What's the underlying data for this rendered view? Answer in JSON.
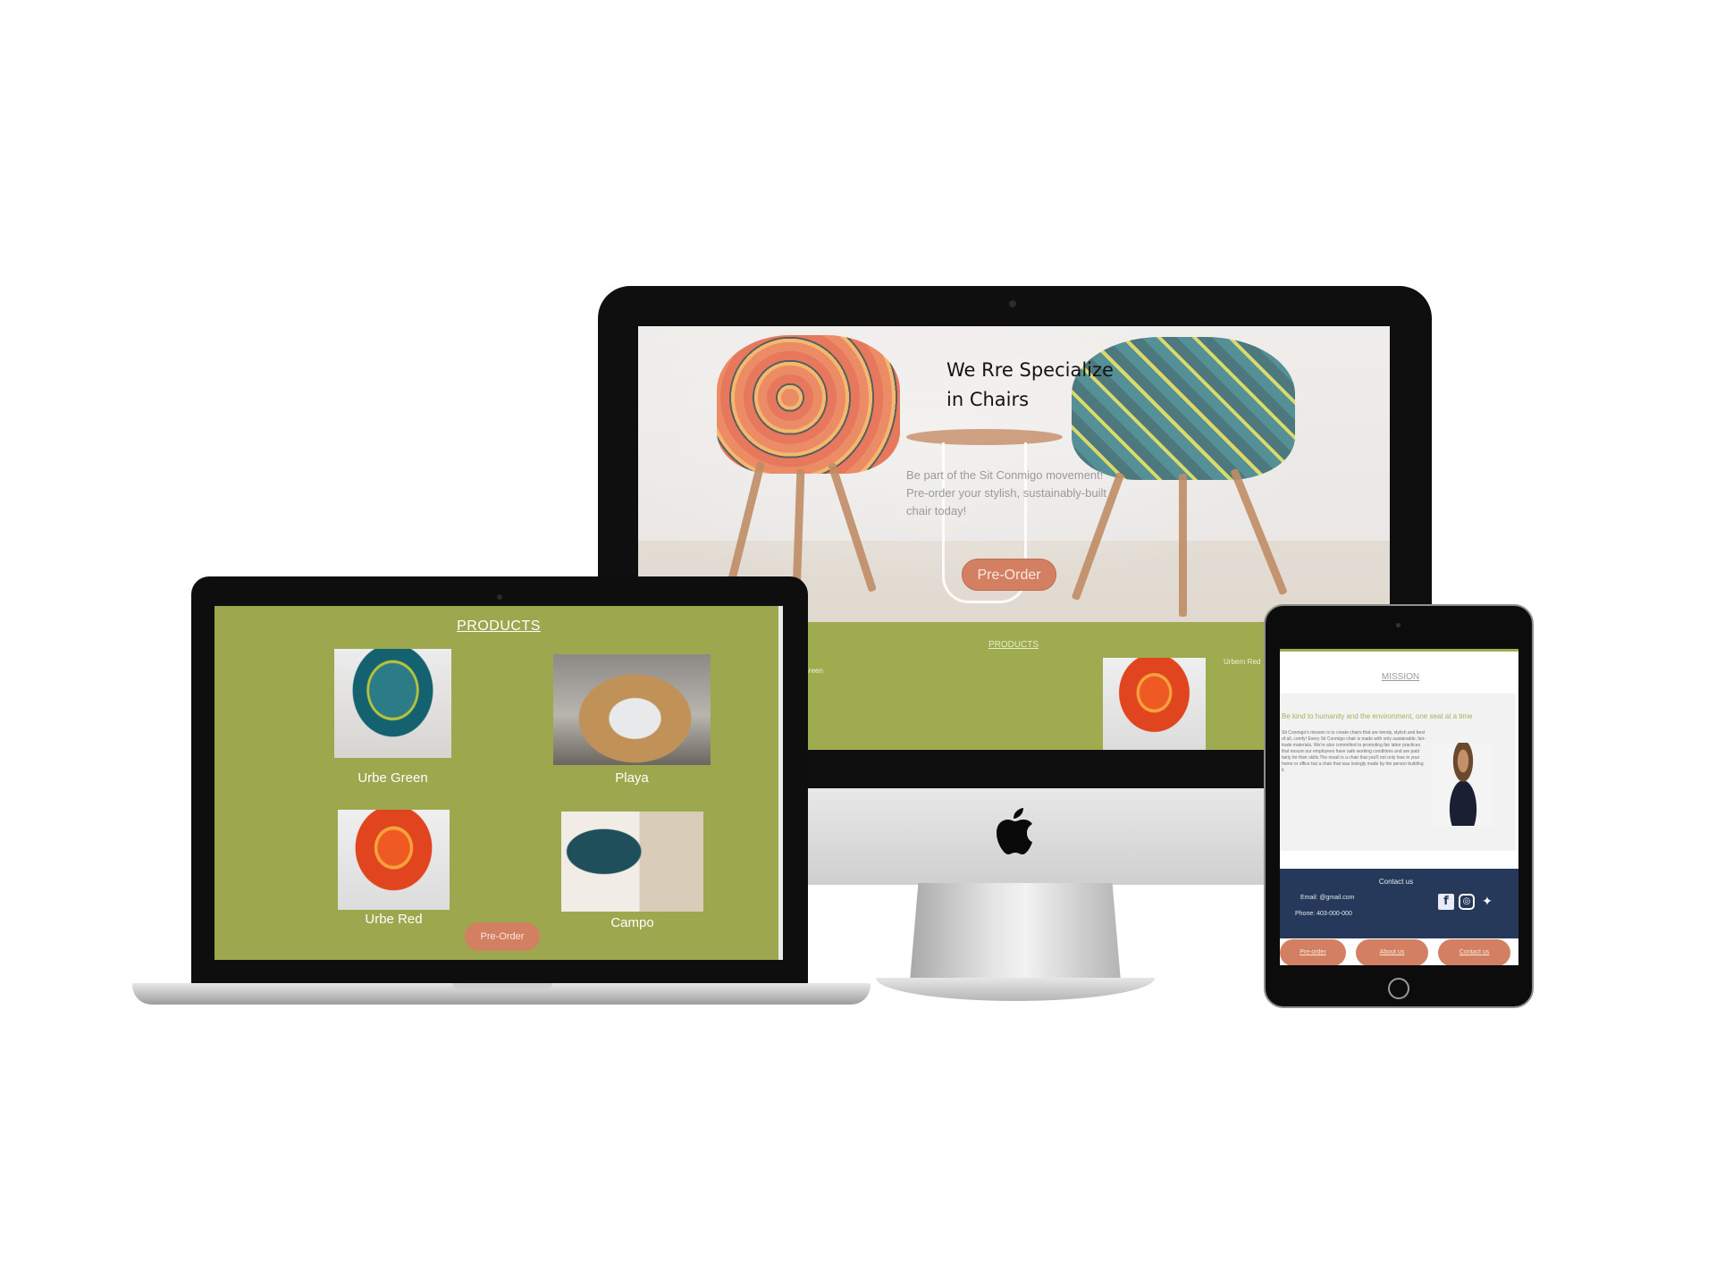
{
  "imac": {
    "hero": {
      "title": "We Rre Specialize in Chairs",
      "subtitle": "Be part of the Sit Conmigo movement! Pre-order your stylish, sustainably-built chair today!",
      "button_label": "Pre-Order"
    },
    "products": {
      "title": "PRODUCTS",
      "items": [
        {
          "label": "Urbern Green"
        },
        {
          "label": "Urbern Red"
        }
      ]
    }
  },
  "laptop": {
    "products_title": "PRODUCTS",
    "items": [
      {
        "label": "Urbe Green"
      },
      {
        "label": "Playa"
      },
      {
        "label": "Urbe Red"
      },
      {
        "label": "Campo"
      }
    ],
    "button_label": "Pre-Order"
  },
  "tablet": {
    "mission_title": "MISSION",
    "mission_heading": "Be kind to humanity and the environment, one seat at a time",
    "mission_body": "Sit Conmigo's mission is to create chairs that are trendy, stylish and best of all, comfy! Every Sit Conmigo chair is made with only sustainable, fair-trade materials. We're also committed to promoting fair labor practices that ensure our employees have safe working conditions and are paid fairly for their skills.The result is a chair that you'll not only love in your home or office but a chair that was lovingly made by the person building it.",
    "contact_title": "Contact us",
    "email": "Email: @gmail.com",
    "phone": "Phone: 403-000-000",
    "footer_buttons": [
      "Pre-order",
      "About us",
      "Contact us"
    ],
    "social_icons": [
      "facebook-icon",
      "instagram-icon",
      "twitter-icon"
    ]
  },
  "colors": {
    "olive": "#9eab4e",
    "salmon": "#d37f61",
    "navy": "#26395a"
  }
}
